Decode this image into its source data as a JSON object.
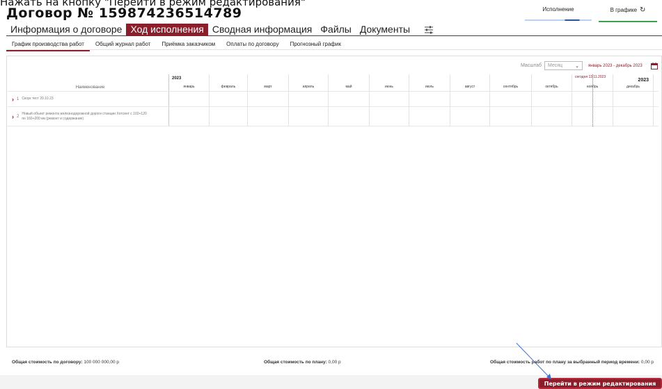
{
  "instruction": "Нажать на кнопку \"Перейти в режим редактирования\"",
  "contract_title": "Договор № 159874236514789",
  "status": {
    "execution_label": "Исполнение",
    "schedule_label": "В графике",
    "execution_progress": 0.22
  },
  "main_tabs": [
    "Информация о договоре",
    "Ход исполнения",
    "Сводная информация",
    "Файлы",
    "Документы"
  ],
  "sub_tabs": [
    "График производства работ",
    "Общий журнал работ",
    "Приёмка заказчиком",
    "Оплаты по договору",
    "Прогнозный график"
  ],
  "scale": {
    "label": "Масштаб",
    "value": "Месяц"
  },
  "period": "январь 2023 - декабрь 2023",
  "grid": {
    "name_header": "Наименование",
    "year_left": "2023",
    "year_right": "2023",
    "today_label": "сегодня 13.11.2023",
    "months": [
      "январь",
      "февраль",
      "март",
      "апрель",
      "май",
      "июнь",
      "июль",
      "август",
      "сентябрь",
      "октябрь",
      "ноябрь",
      "декабрь"
    ],
    "rows": [
      {
        "num": "1",
        "text": "Скоук тест 20.10.23"
      },
      {
        "num": "2",
        "text": "Новый объект ремонта железнодорожной дороги станции Хотсинт с 102+120 по 160+200 км (ремонт и содержание)"
      }
    ]
  },
  "footer": {
    "contract_cost_label": "Общая стоимость по договору:",
    "contract_cost_value": "100 000 000,00 р",
    "plan_cost_label": "Общая стоимость по плану:",
    "plan_cost_value": "0,00 р",
    "period_cost_label": "Общая стоимость работ по плану за выбранный период времени:",
    "period_cost_value": "0,00 р"
  },
  "edit_button_label": "Перейти в режим редактирования",
  "colors": {
    "brand": "#8b1e2b",
    "schedule_ok": "#3aa04b",
    "execution": "#2a52a3"
  }
}
